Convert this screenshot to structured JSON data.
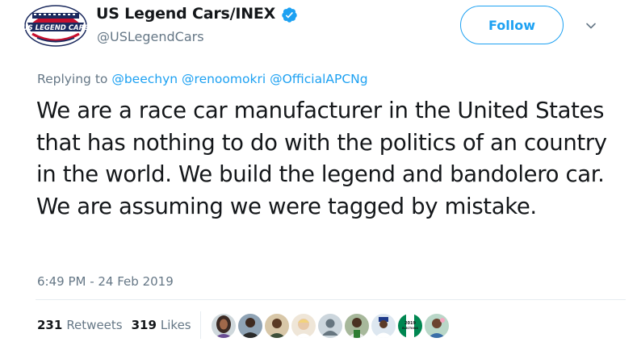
{
  "author": {
    "display_name": "US Legend Cars/INEX",
    "handle": "@USLegendCars",
    "verified": true,
    "avatar_text": "US LEGEND CARS"
  },
  "follow_label": "Follow",
  "reply": {
    "prefix": "Replying to",
    "mentions": [
      "@beechyn",
      "@renoomokri",
      "@OfficialAPCNg"
    ]
  },
  "tweet_text": "We are a race car manufacturer in the United States that has nothing to do with the politics of an country in the world. We build the legend and bandolero car. We are assuming we were tagged by mistake.",
  "timestamp": "6:49 PM - 24 Feb 2019",
  "stats": {
    "retweets_count": "231",
    "retweets_label": "Retweets",
    "likes_count": "319",
    "likes_label": "Likes"
  },
  "liker_badges": [
    "2019",
    "ELECTIONS"
  ],
  "colors": {
    "accent": "#1da1f2",
    "muted": "#657786",
    "text": "#14171a",
    "divider": "#e6ecf0"
  }
}
